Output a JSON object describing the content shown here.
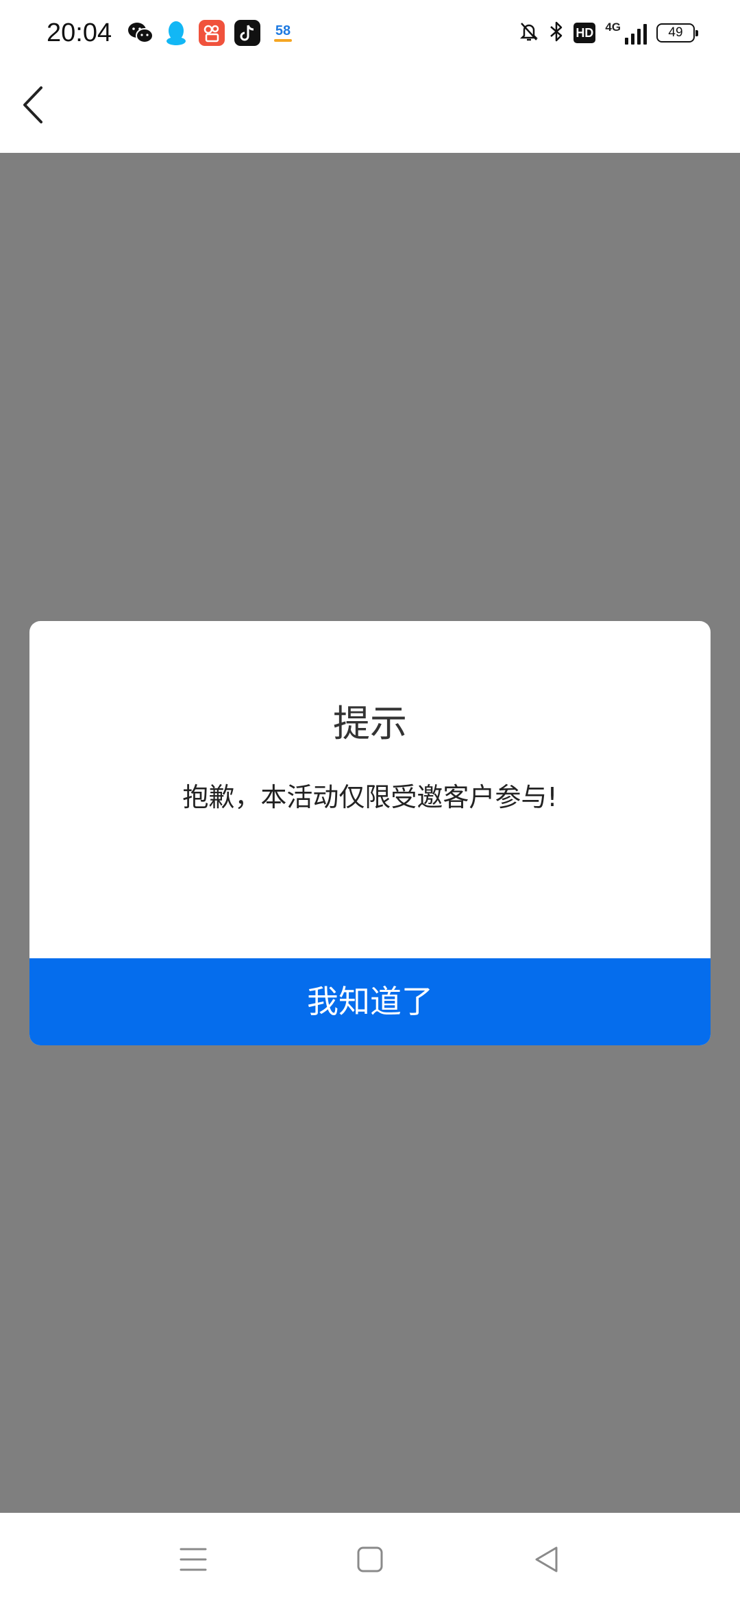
{
  "status_bar": {
    "time": "20:04",
    "network_label": "4G",
    "hd_label": "HD",
    "battery_level": "49",
    "notification_icons": [
      "wechat-icon",
      "qq-icon",
      "kuaishou-icon",
      "douyin-icon",
      "app-58-icon"
    ],
    "app58_label": "58"
  },
  "nav": {
    "back_icon": "chevron-left-icon"
  },
  "dialog": {
    "title": "提示",
    "message": "抱歉，本活动仅限受邀客户参与!",
    "confirm_label": "我知道了"
  },
  "system_nav": {
    "icons": [
      "menu-icon",
      "home-icon",
      "back-triangle-icon"
    ]
  },
  "colors": {
    "overlay": "#7f7f7f",
    "primary_button": "#056ded",
    "qq_blue": "#12b7f5",
    "kuaishou_red": "#f0523c"
  }
}
